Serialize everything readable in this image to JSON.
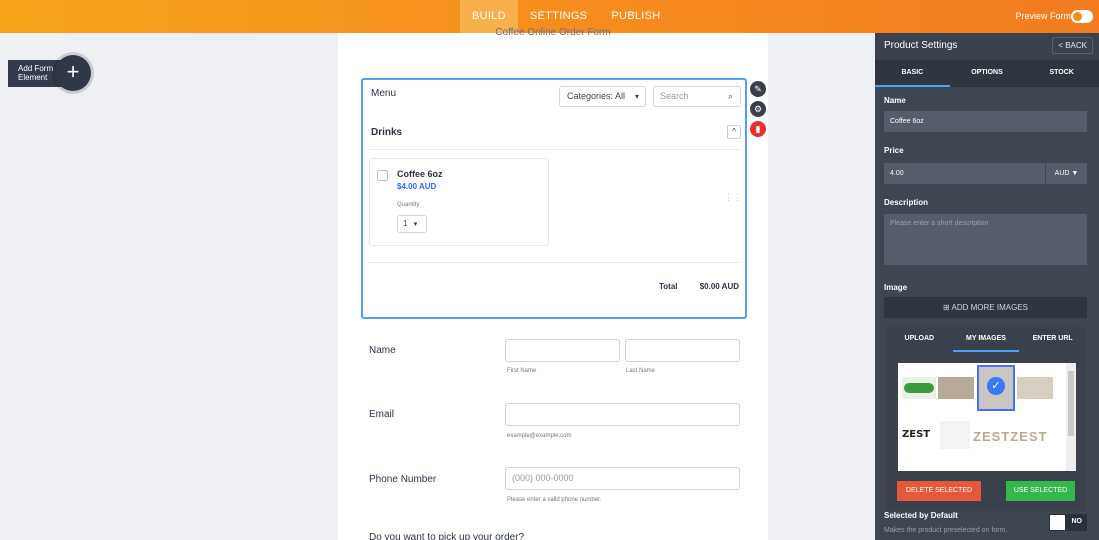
{
  "topnav": {
    "tabs": [
      "BUILD",
      "SETTINGS",
      "PUBLISH"
    ],
    "preview_label": "Preview Form"
  },
  "add_element": {
    "label_line1": "Add Form",
    "label_line2": "Element",
    "plus": "+"
  },
  "form": {
    "title": "Coffee Online Order Form",
    "menu_label": "Menu",
    "categories": "Categories: All",
    "search_placeholder": "Search",
    "category_heading": "Drinks",
    "product": {
      "name": "Coffee 6oz",
      "price": "$4.00 AUD",
      "quantity_label": "Quantity",
      "quantity_value": "1"
    },
    "total_label": "Total",
    "total_value": "$0.00 AUD",
    "name_label": "Name",
    "first_name": "First Name",
    "last_name": "Last Name",
    "email_label": "Email",
    "email_hint": "example@example.com",
    "phone_label": "Phone Number",
    "phone_placeholder": "(000) 000-0000",
    "phone_hint": "Please enter a valid phone number.",
    "pickup_question": "Do you want to pick up your order?"
  },
  "panel": {
    "title": "Product Settings",
    "back": "< BACK",
    "tabs": [
      "BASIC",
      "OPTIONS",
      "STOCK"
    ],
    "name_label": "Name",
    "name_value": "Coffee 6oz",
    "price_label": "Price",
    "price_value": "4.00",
    "currency": "AUD ▼",
    "description_label": "Description",
    "description_placeholder": "Please enter a short description",
    "image_label": "Image",
    "add_images": "ADD MORE IMAGES",
    "selected_default_label": "Selected by Default",
    "selected_default_desc": "Makes the product preselected on form.",
    "selected_default_value": "NO"
  },
  "image_popup": {
    "tabs": [
      "UPLOAD",
      "MY IMAGES",
      "ENTER URL"
    ],
    "delete_btn": "DELETE SELECTED",
    "use_btn": "USE SELECTED",
    "thumb_text": [
      "ZEST",
      "ZESTZEST"
    ]
  },
  "colors": {
    "accent": "#f68a1e",
    "selection": "#4ea1f7",
    "delete": "#e5583b",
    "use": "#33b84b"
  }
}
